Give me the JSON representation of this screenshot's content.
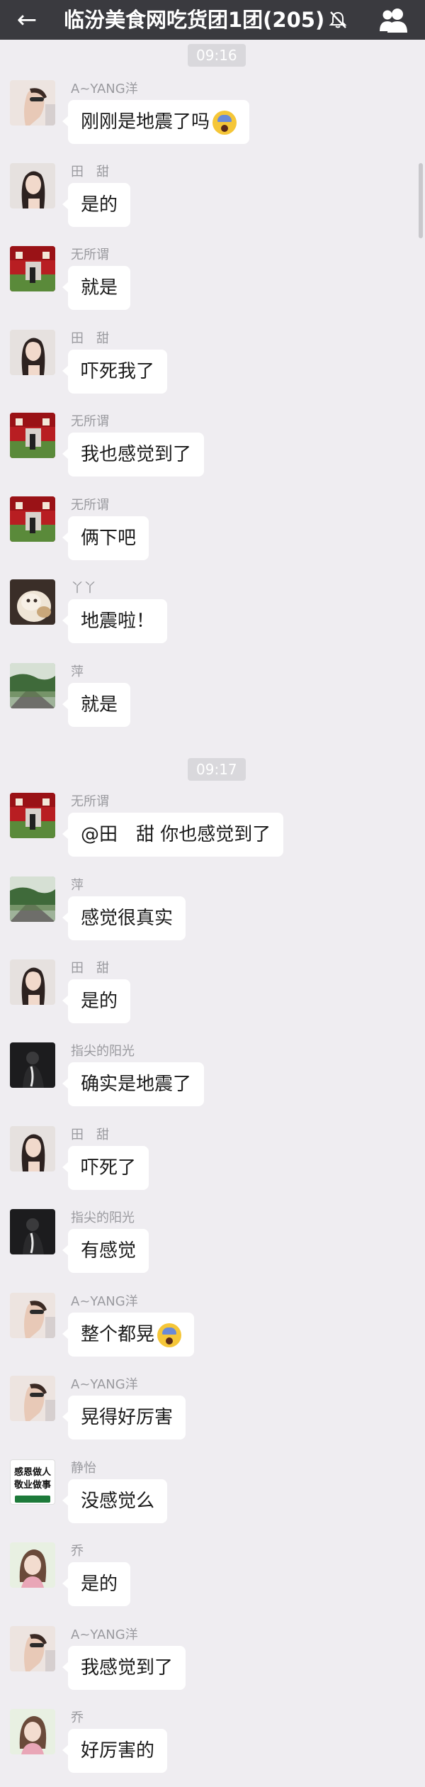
{
  "header": {
    "title": "临汾美食网吃货团1团(205)",
    "back_icon": "back-arrow-icon",
    "mute_icon": "mute-bell-icon",
    "group_icon": "group-members-icon",
    "bar_color": "#3a3a3f"
  },
  "timestamps": [
    "09:16",
    "09:17"
  ],
  "messages": [
    {
      "name": "A~YANG洋",
      "text": "刚刚是地震了吗",
      "emoji": "scream-emoji",
      "avatar": "woman-sunglasses-avatar"
    },
    {
      "name": "田　甜",
      "text": "是的",
      "avatar": "girl-portrait-avatar"
    },
    {
      "name": "无所谓",
      "text": "就是",
      "avatar": "red-stage-avatar"
    },
    {
      "name": "田　甜",
      "text": "吓死我了",
      "avatar": "girl-portrait-avatar"
    },
    {
      "name": "无所谓",
      "text": "我也感觉到了",
      "avatar": "red-stage-avatar"
    },
    {
      "name": "无所谓",
      "text": "俩下吧",
      "avatar": "red-stage-avatar"
    },
    {
      "name": "丫丫",
      "text": "地震啦！",
      "avatar": "cat-avatar"
    },
    {
      "name": "萍",
      "text": "就是",
      "avatar": "road-landscape-avatar"
    },
    {
      "name": "无所谓",
      "text": "@田　甜 你也感觉到了",
      "avatar": "red-stage-avatar"
    },
    {
      "name": "萍",
      "text": "感觉很真实",
      "avatar": "road-landscape-avatar"
    },
    {
      "name": "田　甜",
      "text": "是的",
      "avatar": "girl-portrait-avatar"
    },
    {
      "name": "指尖的阳光",
      "text": "确实是地震了",
      "avatar": "dark-silhouette-avatar"
    },
    {
      "name": "田　甜",
      "text": "吓死了",
      "avatar": "girl-portrait-avatar"
    },
    {
      "name": "指尖的阳光",
      "text": "有感觉",
      "avatar": "dark-silhouette-avatar"
    },
    {
      "name": "A~YANG洋",
      "text": "整个都晃",
      "emoji": "scream-emoji",
      "avatar": "woman-sunglasses-avatar"
    },
    {
      "name": "A~YANG洋",
      "text": "晃得好厉害",
      "avatar": "woman-sunglasses-avatar"
    },
    {
      "name": "静怡",
      "text": "没感觉么",
      "avatar": "slogan-avatar",
      "avatar_text": [
        "感恩做人",
        "敬业做事"
      ]
    },
    {
      "name": "乔",
      "text": "是的",
      "avatar": "girl-pink-avatar"
    },
    {
      "name": "A~YANG洋",
      "text": "我感觉到了",
      "avatar": "woman-sunglasses-avatar"
    },
    {
      "name": "乔",
      "text": "好厉害的",
      "avatar": "girl-pink-avatar"
    }
  ]
}
